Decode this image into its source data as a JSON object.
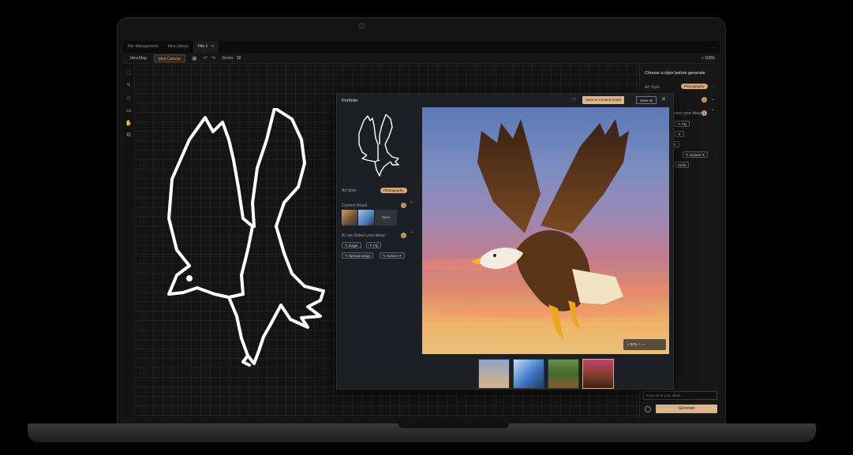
{
  "tabs": [
    {
      "label": "File Management"
    },
    {
      "label": "Idea Library"
    },
    {
      "label": "File 1",
      "closable": true
    }
  ],
  "tabbar_more": "...",
  "toolbar": {
    "idea_map": "Idea Map",
    "idea_canvas": "Idea Canvas",
    "stroke_label": "Stroke",
    "stroke_value": "10",
    "zoom": "100%"
  },
  "tools": [
    "select-icon",
    "pencil-icon",
    "eraser-icon",
    "frame-icon",
    "hand-icon",
    "export-icon"
  ],
  "right_panel": {
    "title": "Choose a style before generate",
    "art_style_label": "Art Style",
    "art_style_value": "Photography",
    "more": "...",
    "content_board_count": "2",
    "detect_label": "Ai can Detect your ideas!",
    "detect_count": "4",
    "tags": [
      "Fly",
      "",
      "",
      "Sunset",
      "Birds"
    ],
    "input_placeholder": "Keep input your ideas",
    "generate": "Generate"
  },
  "portfolio": {
    "title": "Portfolio",
    "save_to_board": "Save to Content board",
    "save_as": "Save as",
    "close": "✕",
    "art_style_label": "Art Style",
    "art_style_value": "Photography",
    "content_board_label": "Content Board",
    "content_board_count": "2",
    "content_board_save": "Save",
    "detect_label": "AI can Detect your ideas!",
    "detect_count": "4",
    "tags": [
      "Eagle",
      "Fly",
      "Spread wings",
      "Sunset"
    ],
    "zoom": "80%"
  },
  "colors": {
    "accent": "#e0b58a",
    "background": "#121212",
    "modal": "#1c1f24"
  }
}
